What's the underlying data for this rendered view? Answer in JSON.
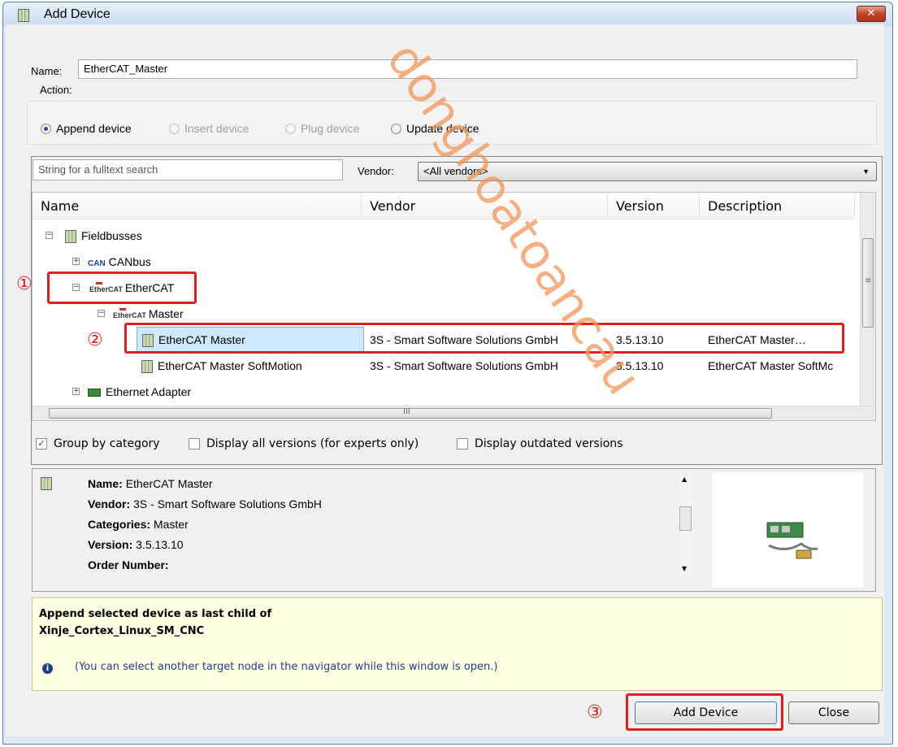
{
  "window": {
    "title": "Add Device",
    "close_glyph": "✕"
  },
  "name_field": {
    "label": "Name:",
    "value": "EtherCAT_Master"
  },
  "action": {
    "label": "Action:",
    "options": [
      {
        "label": "Append device",
        "selected": true,
        "enabled": true
      },
      {
        "label": "Insert device",
        "selected": false,
        "enabled": false
      },
      {
        "label": "Plug device",
        "selected": false,
        "enabled": false
      },
      {
        "label": "Update device",
        "selected": false,
        "enabled": true
      }
    ]
  },
  "search": {
    "placeholder": "String for a fulltext search",
    "vendor_label": "Vendor:",
    "vendor_value": "<All vendors>"
  },
  "table": {
    "columns": [
      "Name",
      "Vendor",
      "Version",
      "Description"
    ],
    "rows": [
      {
        "name": "Fieldbusses",
        "vendor": "",
        "version": "",
        "description": "",
        "icon": "device-icon",
        "expander": "−"
      },
      {
        "name": "CANbus",
        "vendor": "",
        "version": "",
        "description": "",
        "icon": "can-icon",
        "expander": "+"
      },
      {
        "name": "EtherCAT",
        "vendor": "",
        "version": "",
        "description": "",
        "icon": "ethercat-icon",
        "expander": "−"
      },
      {
        "name": "Master",
        "vendor": "",
        "version": "",
        "description": "",
        "icon": "ethercat-icon",
        "expander": "−"
      },
      {
        "name": "EtherCAT Master",
        "vendor": "3S - Smart Software Solutions GmbH",
        "version": "3.5.13.10",
        "description": "EtherCAT Master…",
        "icon": "device-icon",
        "selected": true
      },
      {
        "name": "EtherCAT Master SoftMotion",
        "vendor": "3S - Smart Software Solutions GmbH",
        "version": "3.5.13.10",
        "description": "EtherCAT Master SoftMc",
        "icon": "device-icon"
      },
      {
        "name": "Ethernet Adapter",
        "vendor": "",
        "version": "",
        "description": "",
        "icon": "ethernet-icon",
        "expander": "+"
      }
    ],
    "hscroll_grip": "III",
    "vscroll_grip": "≡"
  },
  "options": {
    "group_by_category": {
      "label": "Group by category",
      "checked": true
    },
    "display_all_versions": {
      "label": "Display all versions (for experts only)",
      "checked": false
    },
    "display_outdated": {
      "label": "Display outdated versions",
      "checked": false
    }
  },
  "details": {
    "name_label": "Name:",
    "name_value": "EtherCAT Master",
    "vendor_label": "Vendor:",
    "vendor_value": "3S - Smart Software Solutions GmbH",
    "categories_label": "Categories:",
    "categories_value": "Master",
    "version_label": "Version:",
    "version_value": "3.5.13.10",
    "order_label": "Order Number:"
  },
  "hint": {
    "line1": "Append selected device as last child of",
    "line2": "Xinje_Cortex_Linux_SM_CNC",
    "note": "(You can select another target node in the navigator while this window is open.)",
    "info_glyph": "i"
  },
  "buttons": {
    "add": "Add Device",
    "close": "Close"
  },
  "annotations": {
    "one": "①",
    "two": "②",
    "three": "③"
  },
  "watermark": "donghoatoancau",
  "colors": {
    "highlight": "#e02020",
    "selection": "#cde8ff",
    "hint_background": "#fefee2"
  }
}
